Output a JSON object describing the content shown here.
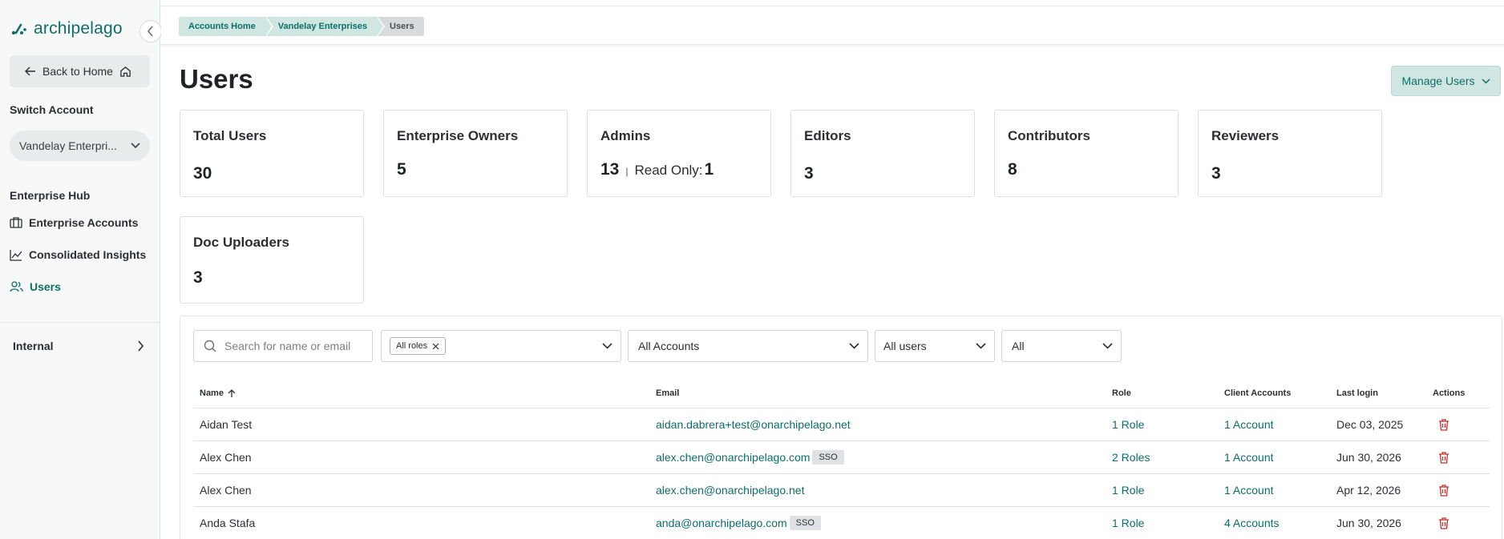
{
  "brand": {
    "name": "archipelago",
    "accent": "#0e6e66"
  },
  "sidebar": {
    "back_label": "Back to Home",
    "switch_account_label": "Switch Account",
    "selected_account": "Vandelay Enterpri...",
    "hub_label": "Enterprise Hub",
    "items": [
      {
        "label": "Enterprise Accounts",
        "icon": "briefcase-icon"
      },
      {
        "label": "Consolidated Insights",
        "icon": "chart-line-icon"
      },
      {
        "label": "Users",
        "icon": "users-icon",
        "active": true
      }
    ],
    "internal_label": "Internal"
  },
  "breadcrumb": [
    "Accounts Home",
    "Vandelay Enterprises",
    "Users"
  ],
  "page": {
    "title": "Users",
    "manage_label": "Manage Users"
  },
  "stats": {
    "total_users": {
      "label": "Total Users",
      "value": "30"
    },
    "enterprise_owners": {
      "label": "Enterprise Owners",
      "value": "5"
    },
    "admins": {
      "label": "Admins",
      "value": "13",
      "sep": "|",
      "read_only_label": "Read Only:",
      "read_only_value": "1"
    },
    "editors": {
      "label": "Editors",
      "value": "3"
    },
    "contributors": {
      "label": "Contributors",
      "value": "8"
    },
    "reviewers": {
      "label": "Reviewers",
      "value": "3"
    },
    "doc_uploaders": {
      "label": "Doc Uploaders",
      "value": "3"
    }
  },
  "filters": {
    "search_placeholder": "Search for name or email",
    "roles_chip": "All roles",
    "accounts": "All Accounts",
    "users": "All users",
    "status": "All"
  },
  "table": {
    "columns": [
      "Name",
      "Email",
      "Role",
      "Client Accounts",
      "Last login",
      "Actions"
    ],
    "rows": [
      {
        "name": "Aidan Test",
        "email": "aidan.dabrera+test@onarchipelago.net",
        "sso": "",
        "role": "1 Role",
        "client": "1 Account",
        "login": "Dec 03, 2025"
      },
      {
        "name": "Alex Chen",
        "email": "alex.chen@onarchipelago.com",
        "sso": "SSO",
        "role": "2 Roles",
        "client": "1 Account",
        "login": "Jun 30, 2026"
      },
      {
        "name": "Alex Chen",
        "email": "alex.chen@onarchipelago.net",
        "sso": "",
        "role": "1 Role",
        "client": "1 Account",
        "login": "Apr 12, 2026"
      },
      {
        "name": "Anda Stafa",
        "email": "anda@onarchipelago.com",
        "sso": "SSO",
        "role": "1 Role",
        "client": "4 Accounts",
        "login": "Jun 30, 2026"
      }
    ]
  }
}
